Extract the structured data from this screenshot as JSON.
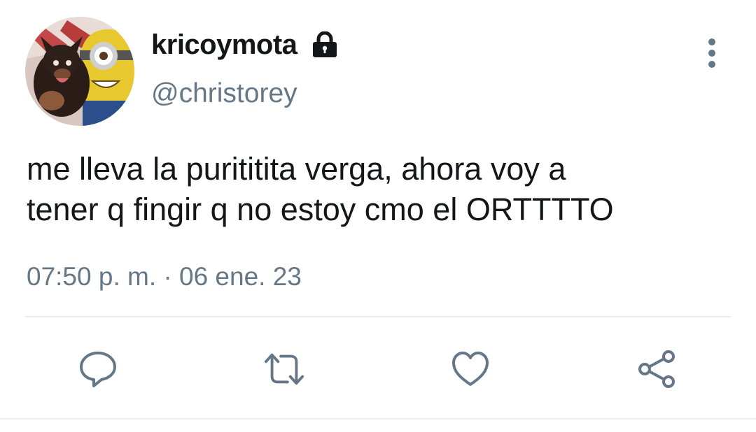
{
  "user": {
    "display_name": "kricoymota",
    "handle": "@christorey",
    "locked_icon": "lock-icon",
    "avatar_icon": "avatar-photo"
  },
  "tweet": {
    "text_line_1": "me lleva la purititita verga, ahora voy a",
    "text_line_2": "tener q fingir q no estoy cmo el ORTTTTO",
    "timestamp": "07:50 p. m. · 06 ene. 23"
  },
  "actions": [
    {
      "name": "reply",
      "icon": "comment-icon"
    },
    {
      "name": "retweet",
      "icon": "retweet-icon"
    },
    {
      "name": "like",
      "icon": "heart-icon"
    },
    {
      "name": "share",
      "icon": "share-icon"
    }
  ],
  "colors": {
    "text": "#14171a",
    "secondary": "#657786",
    "divider": "#e6ecf0"
  }
}
